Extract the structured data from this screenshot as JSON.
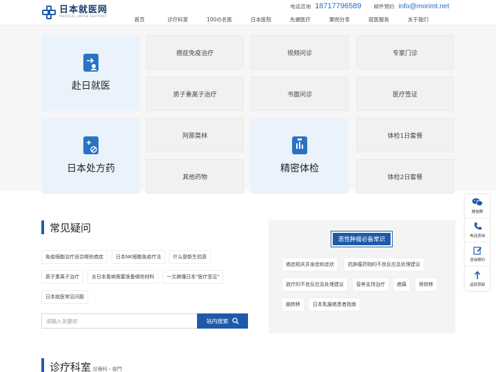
{
  "header": {
    "logo_cn": "日本就医网",
    "logo_en": "MEDICAL JAPAN SUPPORT",
    "phone_label": "电话咨询",
    "phone": "18717796589",
    "mail_label": "邮件预约",
    "mail": "info@morimt.net"
  },
  "nav": [
    "首页",
    "诊疗科室",
    "100の名医",
    "日本医院",
    "先端医疗",
    "案例分享",
    "就医服务",
    "关于我们"
  ],
  "services": {
    "big": [
      "赴日就医",
      "日本处方药",
      "精密体检"
    ],
    "tiles": [
      "癌症免疫治疗",
      "视频问诊",
      "专家门诊",
      "质子重离子治疗",
      "书面问诊",
      "医疗签证",
      "阿那莫林",
      "体检1日套餐",
      "其他药物",
      "体检2日套餐"
    ]
  },
  "faq": {
    "title": "常见疑问",
    "tags": [
      "免疫细胞治疗适合哪些癌症",
      "日本NK细胞免疫疗法",
      "什么是新生抗原",
      "质子重离子治疗",
      "去日本看病需要准备哪些材料",
      "一文搞懂日本\"医疗签证\"",
      "日本就医常见问题"
    ],
    "search_placeholder": "请输入关键词",
    "search_button": "站内搜索"
  },
  "knowledge": {
    "title": "恶性肿瘤必备常识",
    "tags": [
      "癌症相关并发症和症状",
      "抗肿瘤药物的不良反应及处理建议",
      "放疗的不良反应及处理建议",
      "营养支持治疗",
      "癌痛",
      "骨转移",
      "脑转移",
      "日本乳腺癌患者指南"
    ]
  },
  "departments": {
    "title": "诊疗科室",
    "subtitle": "診療科・部門"
  },
  "float": [
    "微信群",
    "电话咨询",
    "咨询预约",
    "返回顶部"
  ]
}
